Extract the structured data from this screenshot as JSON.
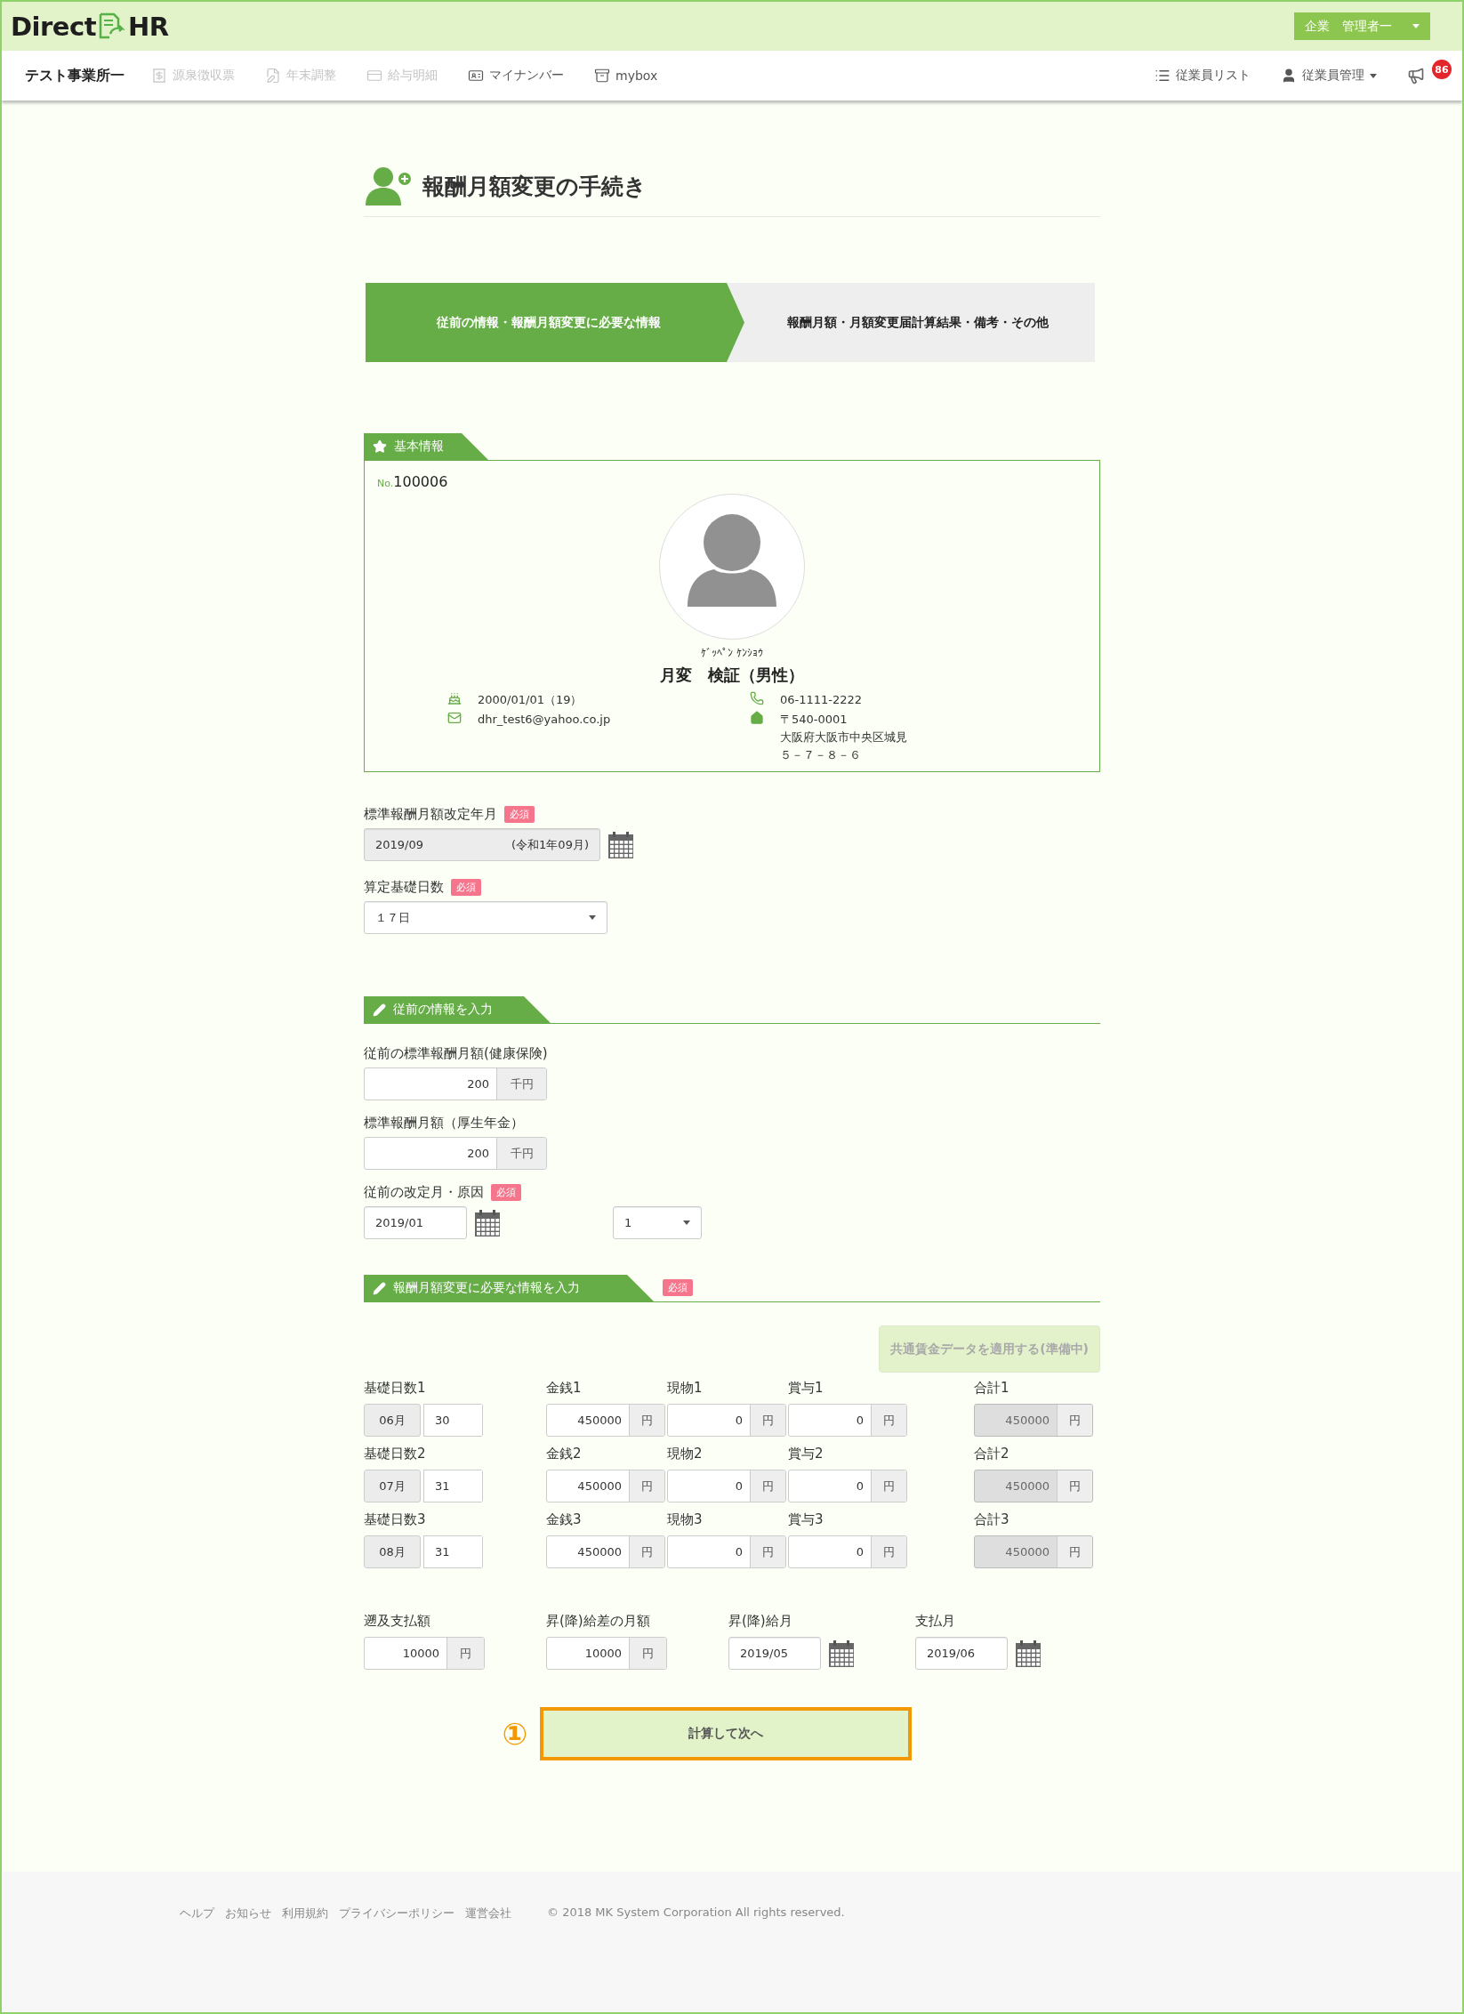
{
  "header": {
    "logo_left": "Direct",
    "logo_right": "HR",
    "user_menu": [
      "企業",
      "管理者一"
    ]
  },
  "nav": {
    "office": "テスト事業所一",
    "items": [
      {
        "label": "源泉徴収票",
        "disabled": true
      },
      {
        "label": "年末調整",
        "disabled": true
      },
      {
        "label": "給与明細",
        "disabled": true
      },
      {
        "label": "マイナンバー",
        "disabled": false
      },
      {
        "label": "mybox",
        "disabled": false
      }
    ],
    "right": [
      {
        "label": "従業員リスト",
        "dropdown": false
      },
      {
        "label": "従業員管理",
        "dropdown": true
      }
    ],
    "notice_count": "86"
  },
  "page": {
    "title": "報酬月額変更の手続き"
  },
  "steps": [
    {
      "label": "従前の情報・報酬月額変更に必要な情報",
      "selected": true
    },
    {
      "label": "報酬月額・月額変更届計算結果・備考・その他",
      "selected": false
    }
  ],
  "basic_info": {
    "heading": "基本情報",
    "no_prefix": "No.",
    "number": "100006",
    "kana": "ｹﾞｯﾍﾟﾝ ｹﾝｼｮｳ",
    "name": "月変　検証（男性）",
    "birth": "2000/01/01（19）",
    "email": "dhr_test6@yahoo.co.jp",
    "phone": "06-1111-2222",
    "postal": "〒540-0001",
    "address": [
      "大阪府大阪市中央区城見",
      "５－７－８－６"
    ]
  },
  "revision": {
    "label": "標準報酬月額改定年月",
    "required": "必須",
    "value": "2019/09",
    "era": "(令和1年09月)",
    "readonly": true
  },
  "basis_days": {
    "label": "算定基礎日数",
    "required": "必須",
    "value": "１７日"
  },
  "previous": {
    "heading": "従前の情報を入力",
    "fields": [
      {
        "label": "従前の標準報酬月額(健康保険)",
        "value": "200",
        "unit": "千円"
      },
      {
        "label": "標準報酬月額（厚生年金）",
        "value": "200",
        "unit": "千円"
      }
    ],
    "revision_label": "従前の改定月・原因",
    "required": "必須",
    "revision_month": "2019/01",
    "cause": "1"
  },
  "change": {
    "heading": "報酬月額変更に必要な情報を入力",
    "required": "必須",
    "apply_button": {
      "label": "共通賃金データを適用する(準備中)",
      "disabled": true
    },
    "months": [
      {
        "days_label": "基礎日数1",
        "month": "06月",
        "days": "30",
        "amounts": [
          {
            "kind": "amount",
            "label": "金銭1",
            "value": "450000",
            "unit": "円",
            "readonly": false
          },
          {
            "kind": "amount",
            "label": "現物1",
            "value": "0",
            "unit": "円",
            "readonly": false
          },
          {
            "kind": "amount",
            "label": "賞与1",
            "value": "0",
            "unit": "円",
            "readonly": false
          },
          {
            "kind": "total",
            "label": "合計1",
            "value": "450000",
            "unit": "円",
            "readonly": true
          }
        ]
      },
      {
        "days_label": "基礎日数2",
        "month": "07月",
        "days": "31",
        "amounts": [
          {
            "kind": "amount",
            "label": "金銭2",
            "value": "450000",
            "unit": "円",
            "readonly": false
          },
          {
            "kind": "amount",
            "label": "現物2",
            "value": "0",
            "unit": "円",
            "readonly": false
          },
          {
            "kind": "amount",
            "label": "賞与2",
            "value": "0",
            "unit": "円",
            "readonly": false
          },
          {
            "kind": "total",
            "label": "合計2",
            "value": "450000",
            "unit": "円",
            "readonly": true
          }
        ]
      },
      {
        "days_label": "基礎日数3",
        "month": "08月",
        "days": "31",
        "amounts": [
          {
            "kind": "amount",
            "label": "金銭3",
            "value": "450000",
            "unit": "円",
            "readonly": false
          },
          {
            "kind": "amount",
            "label": "現物3",
            "value": "0",
            "unit": "円",
            "readonly": false
          },
          {
            "kind": "amount",
            "label": "賞与3",
            "value": "0",
            "unit": "円",
            "readonly": false
          },
          {
            "kind": "total",
            "label": "合計3",
            "value": "450000",
            "unit": "円",
            "readonly": true
          }
        ]
      }
    ],
    "extras": [
      {
        "kind": "amount",
        "label": "遡及支払額",
        "value": "10000",
        "unit": "円"
      },
      {
        "kind": "amount",
        "label": "昇(降)給差の月額",
        "value": "10000",
        "unit": "円"
      },
      {
        "kind": "date",
        "label": "昇(降)給月",
        "value": "2019/05"
      },
      {
        "kind": "date",
        "label": "支払月",
        "value": "2019/06"
      }
    ]
  },
  "submit": {
    "marker": "①",
    "label": "計算して次へ",
    "highlighted": true
  },
  "footer": {
    "links": [
      "ヘルプ",
      "お知らせ",
      "利用規約",
      "プライバシーポリシー",
      "運営会社"
    ],
    "copyright": "© 2018 MK System Corporation All rights reserved."
  }
}
